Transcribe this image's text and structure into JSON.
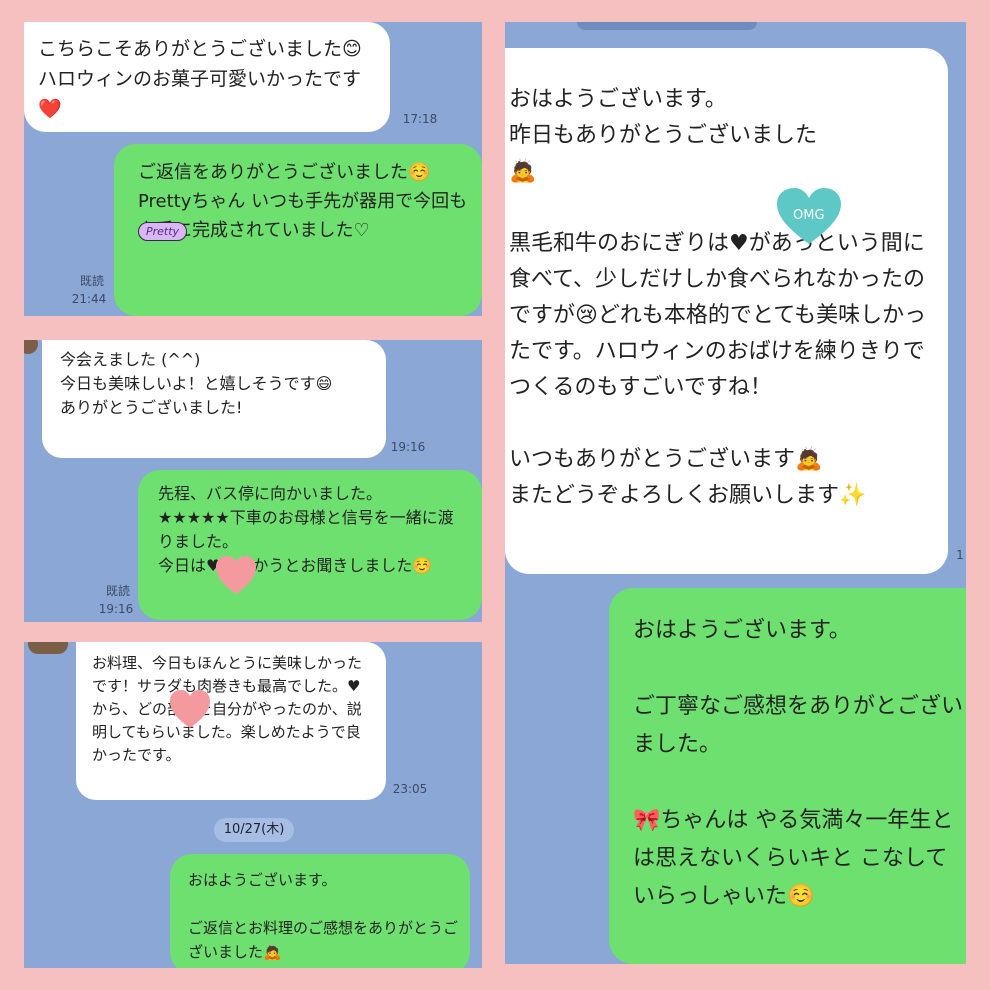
{
  "panel1": {
    "incoming_text": "こちらこそありがとうございました😊ハロウィンのお菓子可愛いかったです❤️",
    "incoming_time": "17:18",
    "outgoing_text": "ご返信をありがとうございました☺️\nPrettyちゃん いつも手先が器用で今回も上手に完成されていました♡",
    "read_label": "既読",
    "outgoing_time": "21:44",
    "sticker_tag": "Pretty"
  },
  "panel2": {
    "incoming_text": "今会えました (^^)\n今日も美味しいよ！と嬉しそうです😄\nありがとうございました!",
    "incoming_time": "19:16",
    "outgoing_text": "先程、バス停に向かいました。\n★★★★★下車のお母様と信号を一緒に渡りました。\n今日は♥に向かうとお聞きしました☺️",
    "read_label": "既読",
    "outgoing_time": "19:16"
  },
  "panel3": {
    "incoming_text": "お料理、今日もほんとうに美味しかったです！サラダも肉巻きも最高でした。♥から、どの部分を自分がやったのか、説明してもらいました。楽しめたようで良かったです。",
    "incoming_time": "23:05",
    "date_label": "10/27(木)",
    "outgoing_text": "おはようございます。\n\nご返信とお料理のご感想をありがとうございました🙇"
  },
  "panel4": {
    "incoming_text": "おはようございます。\n昨日もありがとうございました\n🙇\n\n黒毛和牛のおにぎりは♥があっという間に食べて、少しだけしか食べられなかったのですが😢どれも本格的でとても美味しかったです。ハロウィンのおばけを練りきりでつくるのもすごいですね！\n\nいつもありがとうございます🙇\nまたどうぞよろしくお願いします✨",
    "incoming_time": "1",
    "sticker_omg": "OMG",
    "outgoing_text": "おはようございます。\n\nご丁寧なご感想をありがとございました。\n\n🎀ちゃんは やる気満々一年生とは思えないくらいキと こなしていらっしゃいた☺️"
  },
  "colors": {
    "page_bg": "#f6bfc0",
    "chat_bg": "#8ba7d6",
    "incoming_bubble": "#ffffff",
    "outgoing_bubble": "#6ee06f"
  }
}
